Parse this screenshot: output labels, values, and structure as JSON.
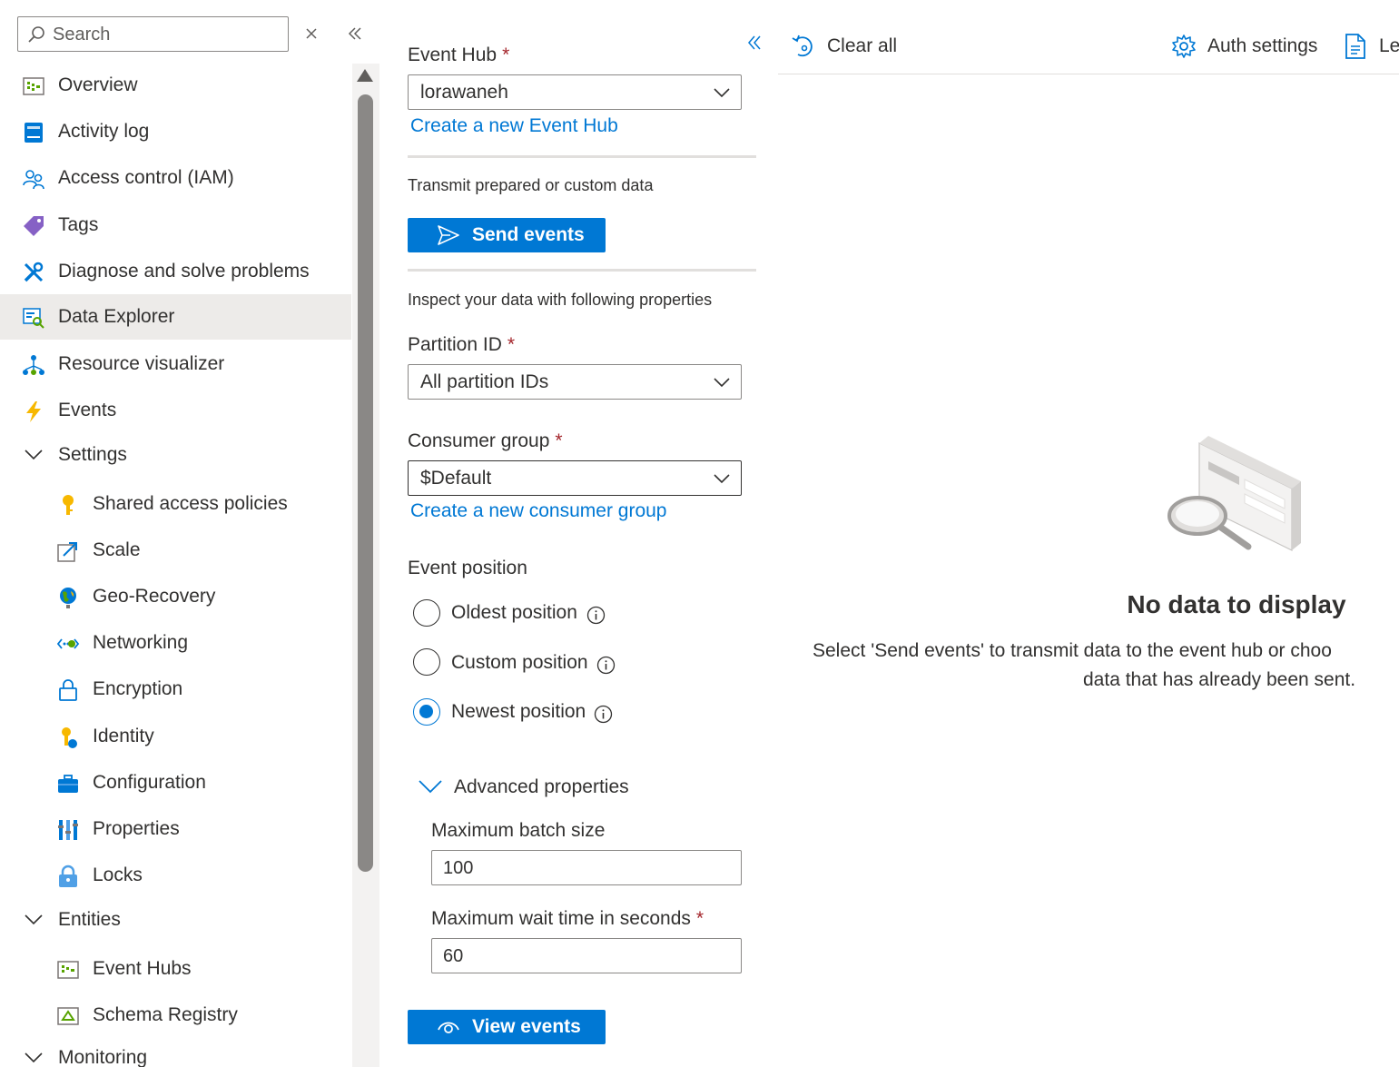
{
  "nav": {
    "search": {
      "placeholder": "Search"
    },
    "items": [
      {
        "label": "Overview",
        "icon": "overview-icon"
      },
      {
        "label": "Activity log",
        "icon": "activity-log-icon"
      },
      {
        "label": "Access control (IAM)",
        "icon": "access-control-icon"
      },
      {
        "label": "Tags",
        "icon": "tag-icon"
      },
      {
        "label": "Diagnose and solve problems",
        "icon": "wrench-icon"
      },
      {
        "label": "Data Explorer",
        "icon": "data-explorer-icon",
        "active": true
      },
      {
        "label": "Resource visualizer",
        "icon": "resource-visualizer-icon"
      },
      {
        "label": "Events",
        "icon": "lightning-icon"
      }
    ],
    "settings_group": {
      "label": "Settings",
      "items": [
        {
          "label": "Shared access policies",
          "icon": "key-icon"
        },
        {
          "label": "Scale",
          "icon": "scale-icon"
        },
        {
          "label": "Geo-Recovery",
          "icon": "globe-icon"
        },
        {
          "label": "Networking",
          "icon": "networking-icon"
        },
        {
          "label": "Encryption",
          "icon": "lock-icon"
        },
        {
          "label": "Identity",
          "icon": "identity-icon"
        },
        {
          "label": "Configuration",
          "icon": "briefcase-icon"
        },
        {
          "label": "Properties",
          "icon": "properties-icon"
        },
        {
          "label": "Locks",
          "icon": "locks-icon"
        }
      ]
    },
    "entities_group": {
      "label": "Entities",
      "items": [
        {
          "label": "Event Hubs",
          "icon": "event-hubs-icon"
        },
        {
          "label": "Schema Registry",
          "icon": "schema-registry-icon"
        }
      ]
    },
    "monitoring_group": {
      "label": "Monitoring"
    }
  },
  "form": {
    "event_hub": {
      "label": "Event Hub",
      "required": "*",
      "value": "lorawaneh",
      "create_link": "Create a new Event Hub"
    },
    "transmit_text": "Transmit prepared or custom data",
    "send_button": "Send events",
    "inspect_text": "Inspect your data with following properties",
    "partition": {
      "label": "Partition ID",
      "required": "*",
      "value": "All partition IDs"
    },
    "consumer_group": {
      "label": "Consumer group",
      "required": "*",
      "value": "$Default",
      "create_link": "Create a new consumer group"
    },
    "event_position": {
      "label": "Event position",
      "options": [
        {
          "label": "Oldest position",
          "checked": false
        },
        {
          "label": "Custom position",
          "checked": false
        },
        {
          "label": "Newest position",
          "checked": true
        }
      ]
    },
    "advanced": {
      "label": "Advanced properties",
      "max_batch": {
        "label": "Maximum batch size",
        "value": "100"
      },
      "max_wait": {
        "label": "Maximum wait time in seconds",
        "required": "*",
        "value": "60"
      }
    },
    "view_button": "View events"
  },
  "toolbar": {
    "clear_all": "Clear all",
    "auth_settings": "Auth settings",
    "learn": "Lea"
  },
  "empty_state": {
    "title": "No data to display",
    "desc_line1": "Select 'Send events' to transmit data to the event hub or choo",
    "desc_line2": "data that has already been sent."
  },
  "colors": {
    "accent": "#0078d4",
    "required": "#a4262c",
    "active_bg": "#edebe9"
  }
}
